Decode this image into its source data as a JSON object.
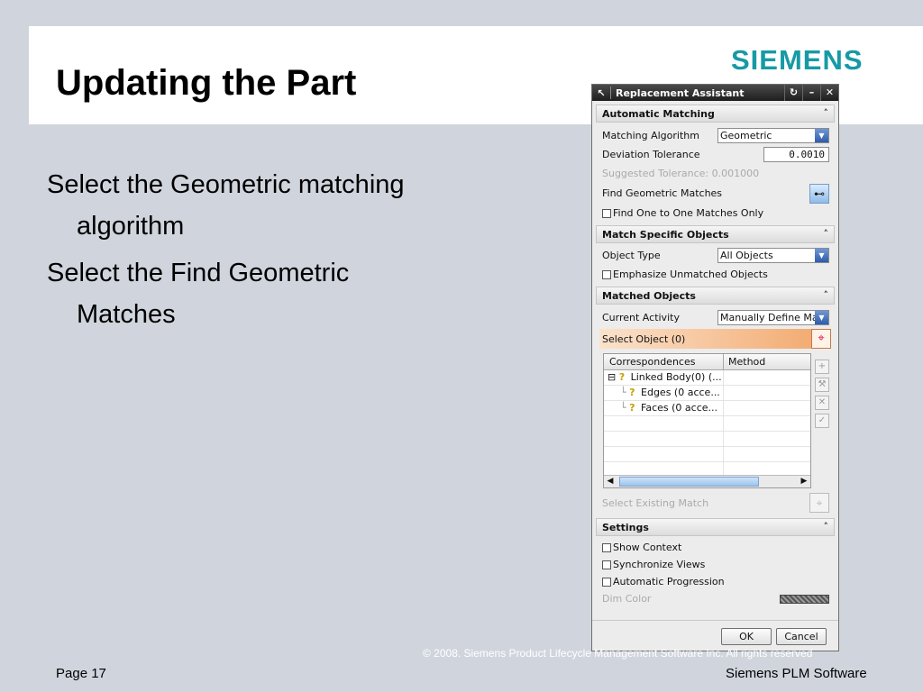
{
  "slide": {
    "title": "Updating the Part",
    "logo": "SIEMENS",
    "bullets": [
      "Select the Geometric matching algorithm",
      "Select the Find Geometric Matches"
    ],
    "footer_page": "Page 17",
    "footer_brand": "Siemens PLM Software",
    "copyright": "© 2008. Siemens Product Lifecycle Management Software Inc. All rights reserved"
  },
  "dialog": {
    "title": "Replacement Assistant",
    "title_icons": [
      "arrow-cursor-icon",
      "reset-icon",
      "minimize-icon",
      "close-icon"
    ],
    "automatic_matching": {
      "header": "Automatic Matching",
      "algorithm_label": "Matching Algorithm",
      "algorithm_value": "Geometric",
      "tolerance_label": "Deviation Tolerance",
      "tolerance_value": "0.0010",
      "suggested": "Suggested Tolerance: 0.001000",
      "find_label": "Find Geometric Matches",
      "one_to_one_label": "Find One to One Matches Only"
    },
    "match_specific": {
      "header": "Match Specific Objects",
      "object_type_label": "Object Type",
      "object_type_value": "All Objects",
      "emphasize_label": "Emphasize Unmatched Objects"
    },
    "matched_objects": {
      "header": "Matched Objects",
      "activity_label": "Current Activity",
      "activity_value": "Manually Define Match",
      "select_object": "Select Object (0)",
      "columns": [
        "Correspondences",
        "Method"
      ],
      "rows": [
        {
          "prefix": "⊟",
          "name": "Linked Body(0) (...",
          "method": ""
        },
        {
          "prefix": "└",
          "name": "Edges (0 acce...",
          "method": ""
        },
        {
          "prefix": "└",
          "name": "Faces (0 acce...",
          "method": ""
        }
      ],
      "select_existing": "Select Existing Match"
    },
    "settings": {
      "header": "Settings",
      "show_context": "Show Context",
      "sync_views": "Synchronize Views",
      "auto_progression": "Automatic Progression",
      "dim_color": "Dim Color"
    },
    "buttons": {
      "ok": "OK",
      "cancel": "Cancel"
    }
  }
}
